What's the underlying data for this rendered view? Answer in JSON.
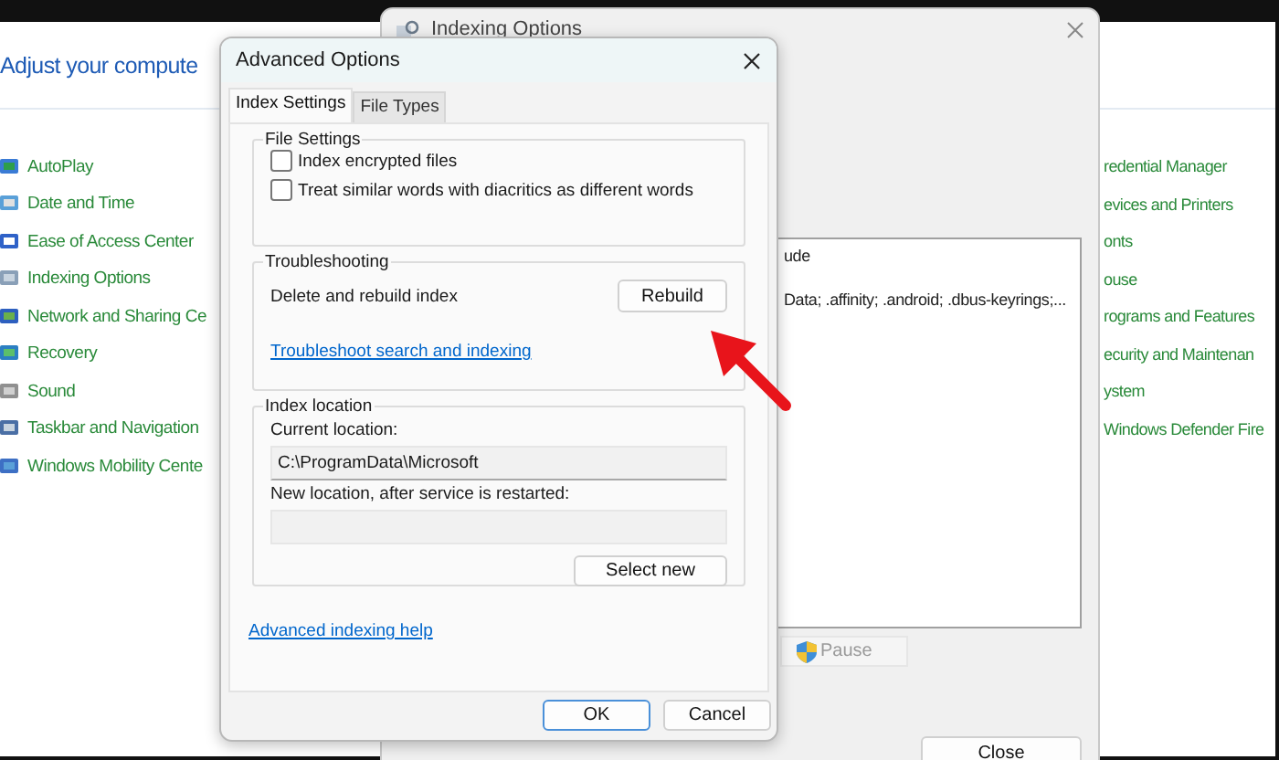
{
  "control_panel": {
    "heading": "Adjust your compute",
    "left_items": [
      "AutoPlay",
      "Date and Time",
      "Ease of Access Center",
      "Indexing Options",
      "Network and Sharing Ce",
      "Recovery",
      "Sound",
      "Taskbar and Navigation",
      "Windows Mobility Cente"
    ],
    "right_items": [
      "redential Manager",
      "evices and Printers",
      "onts",
      "ouse",
      "rograms and Features",
      "ecurity and Maintenan",
      "ystem",
      "Windows Defender Fire"
    ]
  },
  "indexing_window": {
    "title": "Indexing Options",
    "list_lines": [
      "ude",
      "Data; .affinity; .android; .dbus-keyrings;..."
    ],
    "pause_button": "Pause",
    "close_button": "Close"
  },
  "dialog": {
    "title": "Advanced Options",
    "tabs": [
      {
        "label": "Index Settings",
        "selected": true
      },
      {
        "label": "File Types",
        "selected": false
      }
    ],
    "file_settings": {
      "title": "File Settings",
      "checkboxes": [
        {
          "label": "Index encrypted files",
          "checked": false
        },
        {
          "label": "Treat similar words with diacritics as different words",
          "checked": false
        }
      ]
    },
    "troubleshooting": {
      "title": "Troubleshooting",
      "rebuild_label": "Delete and rebuild index",
      "rebuild_button": "Rebuild",
      "link": "Troubleshoot search and indexing"
    },
    "index_location": {
      "title": "Index location",
      "current_label": "Current location:",
      "current_value": "C:\\ProgramData\\Microsoft",
      "new_label": "New location, after service is restarted:",
      "select_button": "Select new"
    },
    "help_link": "Advanced indexing help",
    "buttons": [
      {
        "label": "OK",
        "default": true
      },
      {
        "label": "Cancel",
        "default": false
      }
    ]
  }
}
